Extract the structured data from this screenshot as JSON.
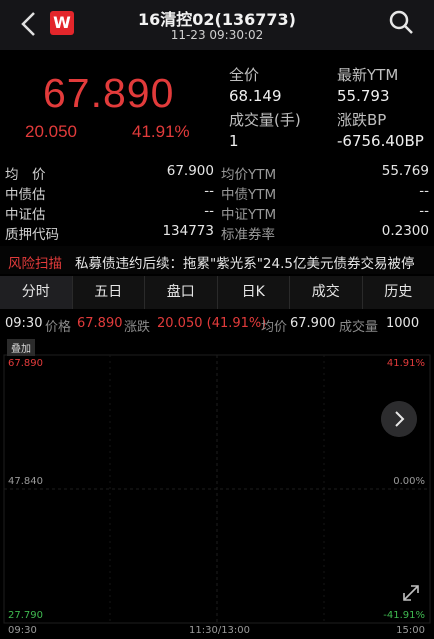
{
  "header": {
    "logo_letter": "W",
    "title": "16清控02(136773)",
    "subtitle": "11-23 09:30:02"
  },
  "quote": {
    "price": "67.890",
    "change": "20.050",
    "change_pct": "41.91%",
    "full_price_label": "全价",
    "full_price": "68.149",
    "ytm_label": "最新YTM",
    "ytm": "55.793",
    "volume_label": "成交量(手)",
    "volume": "1",
    "bp_label": "涨跌BP",
    "bp": "-6756.40BP"
  },
  "info": {
    "rows": [
      {
        "label": "均　价",
        "value": "67.900",
        "label2": "均价YTM",
        "value2": "55.769"
      },
      {
        "label": "中债估",
        "value": "--",
        "label2": "中债YTM",
        "value2": "--"
      },
      {
        "label": "中证估",
        "value": "--",
        "label2": "中证YTM",
        "value2": "--"
      },
      {
        "label": "质押代码",
        "value": "134773",
        "label2": "标准券率",
        "value2": "0.2300"
      }
    ]
  },
  "risk": {
    "tag": "风险扫描",
    "text": "私募债违约后续：拖累\"紫光系\"24.5亿美元债券交易被停"
  },
  "tabs": [
    "分时",
    "五日",
    "盘口",
    "日K",
    "成交",
    "历史"
  ],
  "infoline": {
    "time": "09:30",
    "price_label": "价格",
    "price": "67.890",
    "change_label": "涨跌",
    "change": "20.050 (41.91%)",
    "avg_label": "均价",
    "avg": "67.900",
    "vol_label": "成交量",
    "vol": "1000"
  },
  "chart": {
    "overlay_label": "叠加",
    "y_top": "67.890",
    "y_mid": "47.840",
    "y_bottom": "27.790",
    "pct_top": "41.91%",
    "pct_mid": "0.00%",
    "pct_bottom": "-41.91%",
    "x_start": "09:30",
    "x_mid": "11:30/13:00",
    "x_end": "15:00"
  },
  "colors": {
    "up": "#e23b3b",
    "down": "#3fb950",
    "background": "#000000"
  }
}
